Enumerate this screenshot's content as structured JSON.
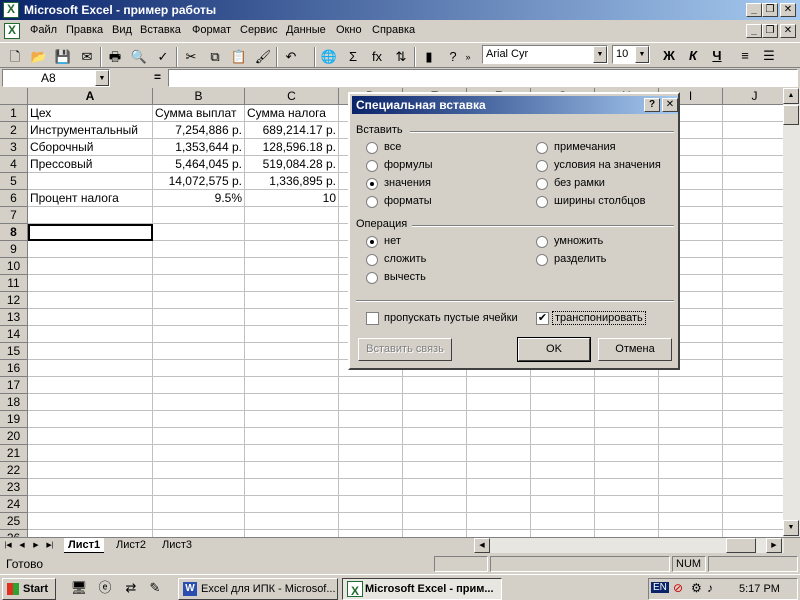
{
  "window": {
    "title": "Microsoft Excel - пример работы",
    "min": "_",
    "restore": "❐",
    "close": "✕"
  },
  "menu": [
    "Файл",
    "Правка",
    "Вид",
    "Вставка",
    "Формат",
    "Сервис",
    "Данные",
    "Окно",
    "Справка"
  ],
  "toolbar": {
    "font": "Arial Cyr",
    "size": "10",
    "bold": "Ж",
    "italic": "К",
    "underline": "Ч"
  },
  "formula": {
    "name_box": "A8",
    "eq": "=",
    "value": ""
  },
  "columns": [
    "A",
    "B",
    "C",
    "D",
    "E",
    "F",
    "G",
    "H",
    "I",
    "J"
  ],
  "rows": [
    {
      "n": "1",
      "a": "Цех",
      "b": "Сумма выплат",
      "c": "Сумма налога"
    },
    {
      "n": "2",
      "a": "Инструментальный",
      "b": "7,254,886 р.",
      "c": "689,214.17 р."
    },
    {
      "n": "3",
      "a": "Сборочный",
      "b": "1,353,644 р.",
      "c": "128,596.18 р."
    },
    {
      "n": "4",
      "a": "Прессовый",
      "b": "5,464,045 р.",
      "c": "519,084.28 р."
    },
    {
      "n": "5",
      "a": "",
      "b": "14,072,575 р.",
      "c": "1,336,895 р."
    },
    {
      "n": "6",
      "a": "Процент налога",
      "b": "9.5%",
      "c": "10"
    },
    {
      "n": "7",
      "a": "",
      "b": "",
      "c": ""
    },
    {
      "n": "8",
      "a": "",
      "b": "",
      "c": ""
    },
    {
      "n": "9",
      "a": "",
      "b": "",
      "c": ""
    },
    {
      "n": "10",
      "a": "",
      "b": "",
      "c": ""
    },
    {
      "n": "11",
      "a": "",
      "b": "",
      "c": ""
    },
    {
      "n": "12",
      "a": "",
      "b": "",
      "c": ""
    },
    {
      "n": "13",
      "a": "",
      "b": "",
      "c": ""
    },
    {
      "n": "14",
      "a": "",
      "b": "",
      "c": ""
    },
    {
      "n": "15",
      "a": "",
      "b": "",
      "c": ""
    },
    {
      "n": "16",
      "a": "",
      "b": "",
      "c": ""
    },
    {
      "n": "17",
      "a": "",
      "b": "",
      "c": ""
    },
    {
      "n": "18",
      "a": "",
      "b": "",
      "c": ""
    },
    {
      "n": "19",
      "a": "",
      "b": "",
      "c": ""
    },
    {
      "n": "20",
      "a": "",
      "b": "",
      "c": ""
    },
    {
      "n": "21",
      "a": "",
      "b": "",
      "c": ""
    },
    {
      "n": "22",
      "a": "",
      "b": "",
      "c": ""
    },
    {
      "n": "23",
      "a": "",
      "b": "",
      "c": ""
    },
    {
      "n": "24",
      "a": "",
      "b": "",
      "c": ""
    },
    {
      "n": "25",
      "a": "",
      "b": "",
      "c": ""
    },
    {
      "n": "26",
      "a": "",
      "b": "",
      "c": ""
    }
  ],
  "sheets": [
    "Лист1",
    "Лист2",
    "Лист3"
  ],
  "status": {
    "ready": "Готово",
    "num": "NUM"
  },
  "dialog": {
    "title": "Специальная вставка",
    "help": "?",
    "close": "✕",
    "paste_group": "Вставить",
    "paste_left": [
      "все",
      "формулы",
      "значения",
      "форматы"
    ],
    "paste_right": [
      "примечания",
      "условия на значения",
      "без рамки",
      "ширины столбцов"
    ],
    "operation_group": "Операция",
    "op_left": [
      "нет",
      "сложить",
      "вычесть"
    ],
    "op_right": [
      "умножить",
      "разделить"
    ],
    "skip_blanks": "пропускать пустые ячейки",
    "transpose": "транспонировать",
    "paste_link": "Вставить связь",
    "ok": "OK",
    "cancel": "Отмена"
  },
  "taskbar": {
    "start": "Start",
    "task1": "Excel для ИПК - Microsof...",
    "task2": "Microsoft Excel - прим...",
    "lang": "EN",
    "clock": "5:17 PM"
  }
}
